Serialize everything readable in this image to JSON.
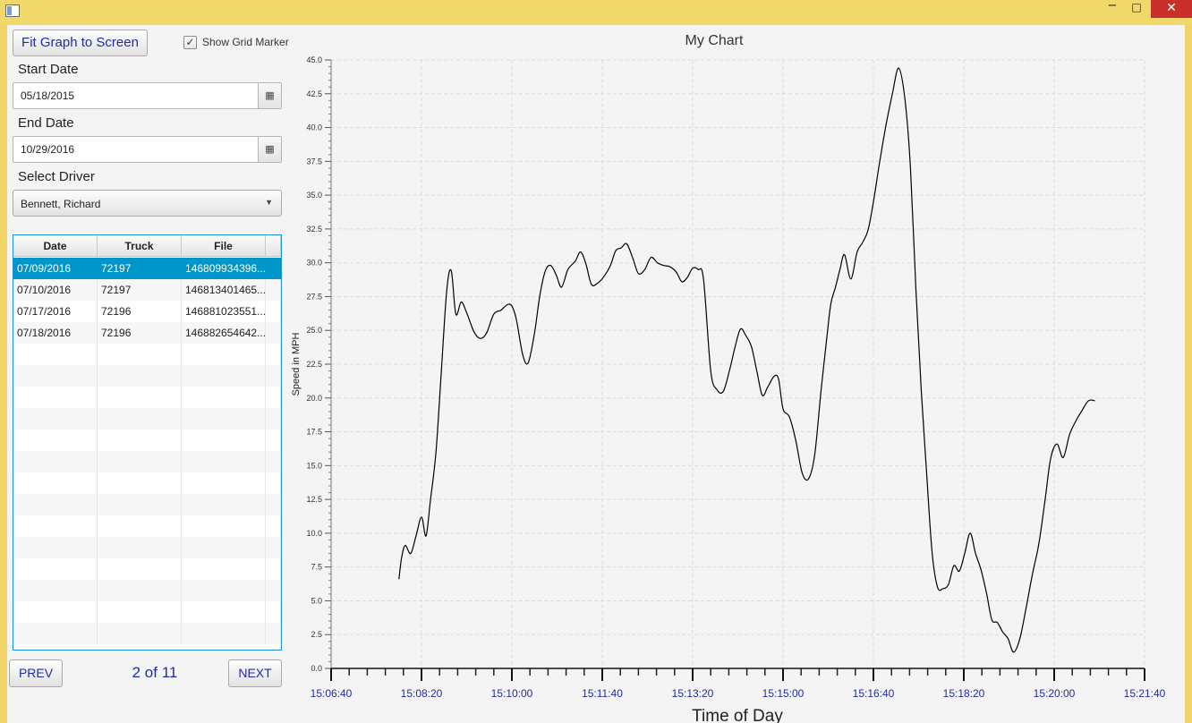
{
  "window": {
    "close_glyph": "✕",
    "min_glyph": "−",
    "max_glyph": "□"
  },
  "controls": {
    "fit_button": "Fit Graph to Screen",
    "show_grid_label": "Show Grid Marker",
    "show_grid_checked": true,
    "check_glyph": "✓",
    "start_date_label": "Start Date",
    "start_date_value": "05/18/2015",
    "end_date_label": "End Date",
    "end_date_value": "10/29/2016",
    "calendar_glyph": "▦",
    "driver_label": "Select Driver",
    "driver_value": "Bennett, Richard",
    "dropdown_glyph": "▼"
  },
  "table": {
    "headers": [
      "Date",
      "Truck",
      "File"
    ],
    "selected_index": 0,
    "rows": [
      [
        "07/09/2016",
        "72197",
        "146809934396..."
      ],
      [
        "07/10/2016",
        "72197",
        "146813401465..."
      ],
      [
        "07/17/2016",
        "72196",
        "146881023551..."
      ],
      [
        "07/18/2016",
        "72196",
        "146882654642..."
      ]
    ]
  },
  "pager": {
    "prev": "PREV",
    "next": "NEXT",
    "indicator": "2 of 11"
  },
  "chart_data": {
    "type": "line",
    "title": "My Chart",
    "xlabel": "Time of Day",
    "ylabel": "Speed in MPH",
    "xlim": [
      "15:06:40",
      "15:21:40"
    ],
    "ylim": [
      0,
      45
    ],
    "x_ticks": [
      "15:06:40",
      "15:08:20",
      "15:10:00",
      "15:11:40",
      "15:13:20",
      "15:15:00",
      "15:16:40",
      "15:18:20",
      "15:20:00",
      "15:21:40"
    ],
    "y_ticks": [
      "0.0",
      "2.5",
      "5.0",
      "7.5",
      "10.0",
      "12.5",
      "15.0",
      "17.5",
      "20.0",
      "22.5",
      "25.0",
      "27.5",
      "30.0",
      "32.5",
      "35.0",
      "37.5",
      "40.0",
      "42.5",
      "45.0"
    ],
    "grid": true,
    "line_color": "#000000",
    "series": [
      {
        "x": [
          "15:07:55",
          "15:07:58",
          "15:08:02",
          "15:08:08",
          "15:08:14",
          "15:08:20",
          "15:08:25",
          "15:08:30",
          "15:08:36",
          "15:08:42",
          "15:08:48",
          "15:08:53",
          "15:08:58",
          "15:09:04",
          "15:09:10",
          "15:09:18",
          "15:09:25",
          "15:09:32",
          "15:09:40",
          "15:09:48",
          "15:09:55",
          "15:10:00",
          "15:10:05",
          "15:10:12",
          "15:10:18",
          "15:10:25",
          "15:10:31",
          "15:10:37",
          "15:10:43",
          "15:10:49",
          "15:10:55",
          "15:11:02",
          "15:11:10",
          "15:11:16",
          "15:11:22",
          "15:11:28",
          "15:11:35",
          "15:11:42",
          "15:11:49",
          "15:11:55",
          "15:12:01",
          "15:12:07",
          "15:12:14",
          "15:12:20",
          "15:12:27",
          "15:12:34",
          "15:12:41",
          "15:12:48",
          "15:12:55",
          "15:13:02",
          "15:13:08",
          "15:13:14",
          "15:13:20",
          "15:13:26",
          "15:13:32",
          "15:13:40",
          "15:13:47",
          "15:13:54",
          "15:14:01",
          "15:14:07",
          "15:14:13",
          "15:14:19",
          "15:14:25",
          "15:14:31",
          "15:14:37",
          "15:14:43",
          "15:14:50",
          "15:14:55",
          "15:15:00",
          "15:15:07",
          "15:15:14",
          "15:15:21",
          "15:15:28",
          "15:15:35",
          "15:15:42",
          "15:15:49",
          "15:15:53",
          "15:15:58",
          "15:16:03",
          "15:16:08",
          "15:16:15",
          "15:16:22",
          "15:16:28",
          "15:16:34",
          "15:16:40",
          "15:16:47",
          "15:16:54",
          "15:17:01",
          "15:17:08",
          "15:17:15",
          "15:17:21",
          "15:17:27",
          "15:17:33",
          "15:17:39",
          "15:17:45",
          "15:17:51",
          "15:17:57",
          "15:18:03",
          "15:18:09",
          "15:18:15",
          "15:18:21",
          "15:18:27",
          "15:18:33",
          "15:18:39",
          "15:18:45",
          "15:18:51",
          "15:18:57",
          "15:19:03",
          "15:19:09",
          "15:19:15",
          "15:19:22",
          "15:19:29",
          "15:19:36",
          "15:19:43",
          "15:19:50",
          "15:19:56",
          "15:20:03",
          "15:20:10",
          "15:20:17",
          "15:20:24",
          "15:20:31",
          "15:20:38",
          "15:20:45"
        ],
        "y": [
          6.6,
          8.2,
          9.1,
          8.5,
          9.8,
          11.2,
          9.8,
          12.5,
          16.0,
          22.0,
          28.0,
          29.4,
          26.2,
          27.1,
          26.3,
          24.9,
          24.4,
          24.8,
          26.2,
          26.5,
          26.9,
          26.8,
          25.8,
          23.2,
          22.6,
          24.8,
          27.6,
          29.4,
          29.8,
          29.1,
          28.2,
          29.5,
          30.1,
          30.8,
          29.9,
          28.4,
          28.5,
          29.0,
          29.8,
          30.9,
          31.1,
          31.4,
          30.3,
          29.2,
          29.5,
          30.4,
          30.0,
          29.8,
          29.7,
          29.3,
          28.6,
          28.9,
          29.6,
          29.5,
          28.8,
          22.0,
          20.6,
          20.5,
          22.1,
          23.8,
          25.1,
          24.6,
          23.8,
          22.0,
          20.2,
          20.8,
          21.6,
          21.4,
          19.2,
          18.6,
          16.9,
          14.5,
          14.0,
          15.8,
          20.5,
          24.8,
          27.0,
          28.2,
          29.5,
          30.6,
          28.8,
          30.8,
          31.5,
          32.4,
          34.5,
          37.5,
          40.2,
          42.5,
          44.4,
          42.0,
          37.0,
          28.0,
          20.5,
          14.3,
          8.5,
          6.0,
          5.9,
          6.2,
          7.6,
          7.2,
          8.5,
          10.0,
          8.5,
          7.3,
          5.6,
          3.6,
          3.4,
          2.7,
          2.2,
          1.2,
          2.2,
          4.5,
          7.0,
          9.2,
          12.5,
          15.5,
          16.6,
          15.6,
          17.3,
          18.3,
          19.1,
          19.8,
          19.8
        ]
      }
    ]
  }
}
